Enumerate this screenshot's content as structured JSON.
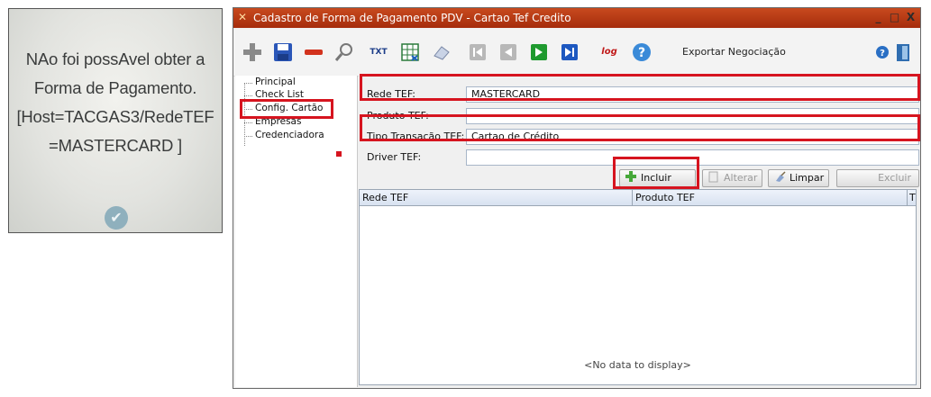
{
  "photo": {
    "lines": [
      "NAo foi possAvel obter a",
      "Forma de Pagamento.",
      "[Host=TACGAS3/RedeTEF",
      "=MASTERCARD  ]"
    ]
  },
  "window": {
    "title": "Cadastro de Forma de Pagamento PDV - Cartao Tef Credito",
    "controls": {
      "minimize": "_",
      "restore": "□",
      "close": "X"
    }
  },
  "toolbar": {
    "export_label": "Exportar Negociação",
    "txt_label": "TXT",
    "log_label": "log"
  },
  "tree": {
    "items": [
      "Principal",
      "Check List",
      "Config. Cartão",
      "Empresas",
      "Credenciadora"
    ]
  },
  "form": {
    "rede_tef": {
      "label": "Rede TEF:",
      "value": "MASTERCARD"
    },
    "produto_tef": {
      "label": "Produto TEF:",
      "value": ""
    },
    "tipo_transacao": {
      "label": "Tipo Transação TEF:",
      "value": "Cartao de Crédito"
    },
    "driver_tef": {
      "label": "Driver TEF:",
      "value": ""
    }
  },
  "buttons": {
    "incluir": "Incluir",
    "alterar": "Alterar",
    "limpar": "Limpar",
    "excluir": "Excluir"
  },
  "grid": {
    "columns": [
      "Rede TEF",
      "Produto TEF",
      "T"
    ],
    "empty_text": "<No data to display>"
  },
  "colors": {
    "titlebar": "#b8381a",
    "highlight": "#d6141f"
  }
}
